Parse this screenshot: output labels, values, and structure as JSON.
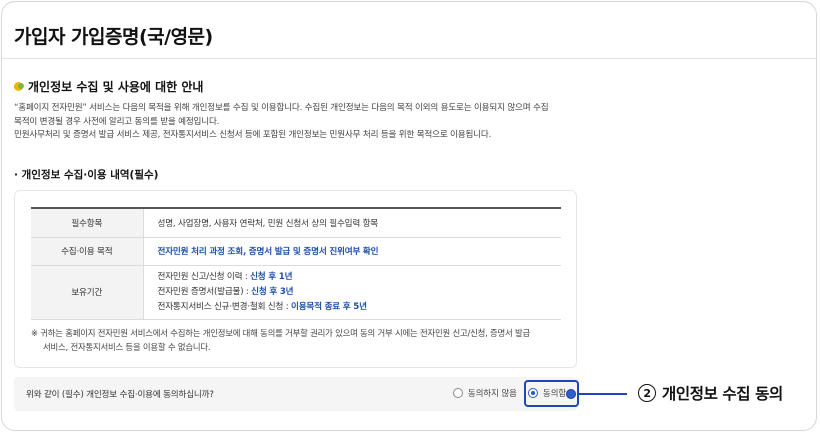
{
  "page": {
    "title": "가입자 가입증명(국/영문)"
  },
  "notice": {
    "icon": "label-tag-icon",
    "heading": "개인정보 수집 및 사용에 대한 안내",
    "lines": [
      "“홈페이지 전자민원” 서비스는 다음의 목적을 위해 개인정보를 수집 및 이용합니다. 수집된 개인정보는 다음의 목적 이외의 용도로는 이용되지 않으며 수집",
      "목적이 변경될 경우 사전에 알리고 동의를 받을 예정입니다.",
      "민원사무처리 및 증명서 발급 서비스 제공, 전자통지서비스 신청서 등에 포함된 개인정보는 민원사무 처리 등을 위한 목적으로 이용됩니다."
    ]
  },
  "collection": {
    "heading": "· 개인정보 수집·이용 내역(필수)",
    "rows": {
      "required_items": {
        "label": "필수항목",
        "value": "성명, 사업장명, 사용자 연락처, 민원 신청서 상의 필수입력 항목"
      },
      "purpose": {
        "label": "수집·이용 목적",
        "value": "전자민원 처리 과정 조회, 증명서 발급 및 증명서 진위여부 확인"
      },
      "retention": {
        "label": "보유기간",
        "items": [
          {
            "prefix": "전자민원 신고/신청 이력 : ",
            "value": "신청 후 1년"
          },
          {
            "prefix": "전자민원 증명서(발급물) : ",
            "value": "신청 후 3년"
          },
          {
            "prefix": "전자통지서비스 신규·변경·철회 신청 : ",
            "value": "이용목적 종료 후 5년"
          }
        ]
      }
    },
    "footnote": {
      "line1": "※ 귀하는 홈페이지 전자민원 서비스에서 수집하는 개인정보에 대해 동의를 거부할 권리가 있으며 동의 거부 시에는 전자민원 신고/신청, 증명서 발급",
      "line2": "서비스, 전자통지서비스 등을 이용할 수 없습니다."
    }
  },
  "consent": {
    "question": "위와 같이 (필수) 개인정보 수집·이용에 동의하십니까?",
    "options": {
      "disagree": "동의하지 않음",
      "agree": "동의함"
    },
    "selected": "agree"
  },
  "annotation": {
    "number": "②",
    "label": "개인정보 수집 동의",
    "color": "#1f46b8"
  }
}
